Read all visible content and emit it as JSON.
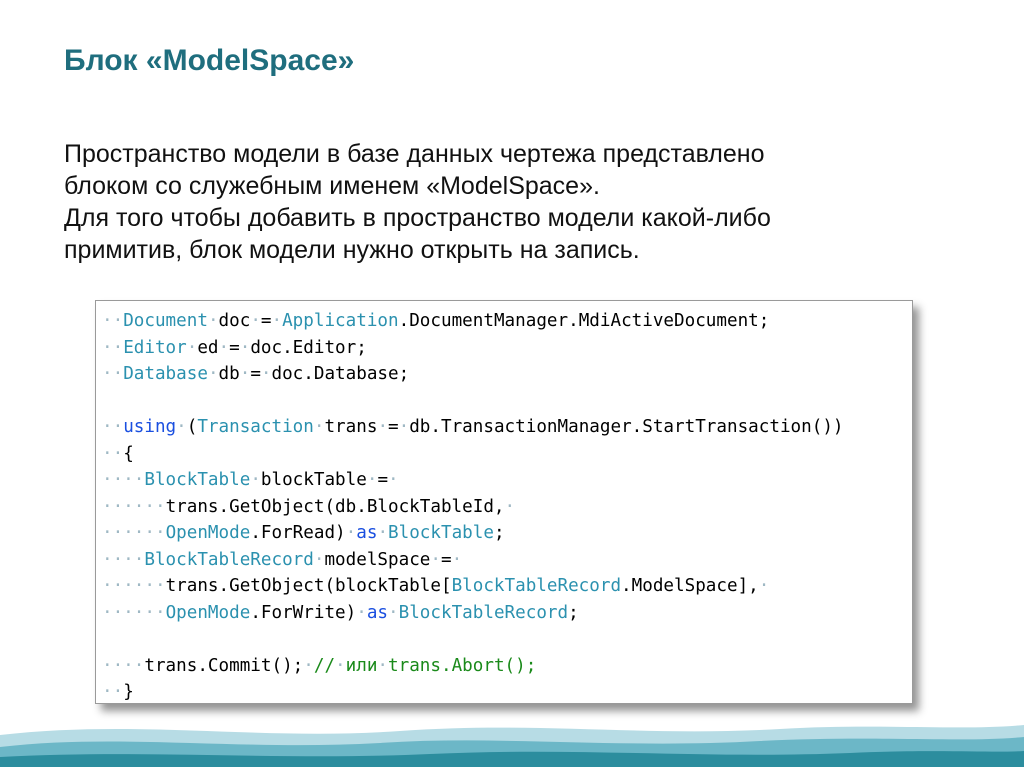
{
  "slide": {
    "title": "Блок «ModelSpace»",
    "paragraphs": [
      "Пространство модели в базе данных чертежа представлено",
      "блоком со служебным именем «ModelSpace».",
      "Для того чтобы добавить в пространство модели какой-либо",
      "примитив, блок модели нужно открыть на запись."
    ]
  },
  "code": {
    "lines": [
      [
        {
          "t": "ws",
          "s": "··"
        },
        {
          "t": "ty",
          "s": "Document"
        },
        {
          "t": "ws",
          "s": "·"
        },
        {
          "t": "tx",
          "s": "doc"
        },
        {
          "t": "ws",
          "s": "·"
        },
        {
          "t": "tx",
          "s": "="
        },
        {
          "t": "ws",
          "s": "·"
        },
        {
          "t": "ty",
          "s": "Application"
        },
        {
          "t": "tx",
          "s": ".DocumentManager.MdiActiveDocument;"
        }
      ],
      [
        {
          "t": "ws",
          "s": "··"
        },
        {
          "t": "ty",
          "s": "Editor"
        },
        {
          "t": "ws",
          "s": "·"
        },
        {
          "t": "tx",
          "s": "ed"
        },
        {
          "t": "ws",
          "s": "·"
        },
        {
          "t": "tx",
          "s": "="
        },
        {
          "t": "ws",
          "s": "·"
        },
        {
          "t": "tx",
          "s": "doc.Editor;"
        }
      ],
      [
        {
          "t": "ws",
          "s": "··"
        },
        {
          "t": "ty",
          "s": "Database"
        },
        {
          "t": "ws",
          "s": "·"
        },
        {
          "t": "tx",
          "s": "db"
        },
        {
          "t": "ws",
          "s": "·"
        },
        {
          "t": "tx",
          "s": "="
        },
        {
          "t": "ws",
          "s": "·"
        },
        {
          "t": "tx",
          "s": "doc.Database;"
        }
      ],
      [
        {
          "t": "tx",
          "s": ""
        }
      ],
      [
        {
          "t": "ws",
          "s": "··"
        },
        {
          "t": "kw",
          "s": "using"
        },
        {
          "t": "ws",
          "s": "·"
        },
        {
          "t": "tx",
          "s": "("
        },
        {
          "t": "ty",
          "s": "Transaction"
        },
        {
          "t": "ws",
          "s": "·"
        },
        {
          "t": "tx",
          "s": "trans"
        },
        {
          "t": "ws",
          "s": "·"
        },
        {
          "t": "tx",
          "s": "="
        },
        {
          "t": "ws",
          "s": "·"
        },
        {
          "t": "tx",
          "s": "db.TransactionManager.StartTransaction())"
        }
      ],
      [
        {
          "t": "ws",
          "s": "··"
        },
        {
          "t": "tx",
          "s": "{"
        }
      ],
      [
        {
          "t": "ws",
          "s": "····"
        },
        {
          "t": "ty",
          "s": "BlockTable"
        },
        {
          "t": "ws",
          "s": "·"
        },
        {
          "t": "tx",
          "s": "blockTable"
        },
        {
          "t": "ws",
          "s": "·"
        },
        {
          "t": "tx",
          "s": "="
        },
        {
          "t": "ws",
          "s": "·"
        }
      ],
      [
        {
          "t": "ws",
          "s": "······"
        },
        {
          "t": "tx",
          "s": "trans.GetObject(db.BlockTableId,"
        },
        {
          "t": "ws",
          "s": "·"
        }
      ],
      [
        {
          "t": "ws",
          "s": "······"
        },
        {
          "t": "ty",
          "s": "OpenMode"
        },
        {
          "t": "tx",
          "s": ".ForRead)"
        },
        {
          "t": "ws",
          "s": "·"
        },
        {
          "t": "kw",
          "s": "as"
        },
        {
          "t": "ws",
          "s": "·"
        },
        {
          "t": "ty",
          "s": "BlockTable"
        },
        {
          "t": "tx",
          "s": ";"
        }
      ],
      [
        {
          "t": "ws",
          "s": "····"
        },
        {
          "t": "ty",
          "s": "BlockTableRecord"
        },
        {
          "t": "ws",
          "s": "·"
        },
        {
          "t": "tx",
          "s": "modelSpace"
        },
        {
          "t": "ws",
          "s": "·"
        },
        {
          "t": "tx",
          "s": "="
        },
        {
          "t": "ws",
          "s": "·"
        }
      ],
      [
        {
          "t": "ws",
          "s": "······"
        },
        {
          "t": "tx",
          "s": "trans.GetObject(blockTable["
        },
        {
          "t": "ty",
          "s": "BlockTableRecord"
        },
        {
          "t": "tx",
          "s": ".ModelSpace],"
        },
        {
          "t": "ws",
          "s": "·"
        }
      ],
      [
        {
          "t": "ws",
          "s": "······"
        },
        {
          "t": "ty",
          "s": "OpenMode"
        },
        {
          "t": "tx",
          "s": ".ForWrite)"
        },
        {
          "t": "ws",
          "s": "·"
        },
        {
          "t": "kw",
          "s": "as"
        },
        {
          "t": "ws",
          "s": "·"
        },
        {
          "t": "ty",
          "s": "BlockTableRecord"
        },
        {
          "t": "tx",
          "s": ";"
        }
      ],
      [
        {
          "t": "tx",
          "s": ""
        }
      ],
      [
        {
          "t": "ws",
          "s": "····"
        },
        {
          "t": "tx",
          "s": "trans.Commit();"
        },
        {
          "t": "ws",
          "s": "·"
        },
        {
          "t": "cm",
          "s": "//"
        },
        {
          "t": "ws",
          "s": "·"
        },
        {
          "t": "cm",
          "s": "или"
        },
        {
          "t": "ws",
          "s": "·"
        },
        {
          "t": "cm",
          "s": "trans.Abort();"
        }
      ],
      [
        {
          "t": "ws",
          "s": "··"
        },
        {
          "t": "tx",
          "s": "}"
        }
      ]
    ]
  },
  "colors": {
    "title": "#1f6e7e",
    "keyword": "#1a4fe0",
    "type": "#2b91af",
    "comment": "#1a8a1a",
    "whitespace_marker": "#9fb8c4",
    "wave_dark": "#2c8d9e",
    "wave_light": "#9fd0dc"
  }
}
